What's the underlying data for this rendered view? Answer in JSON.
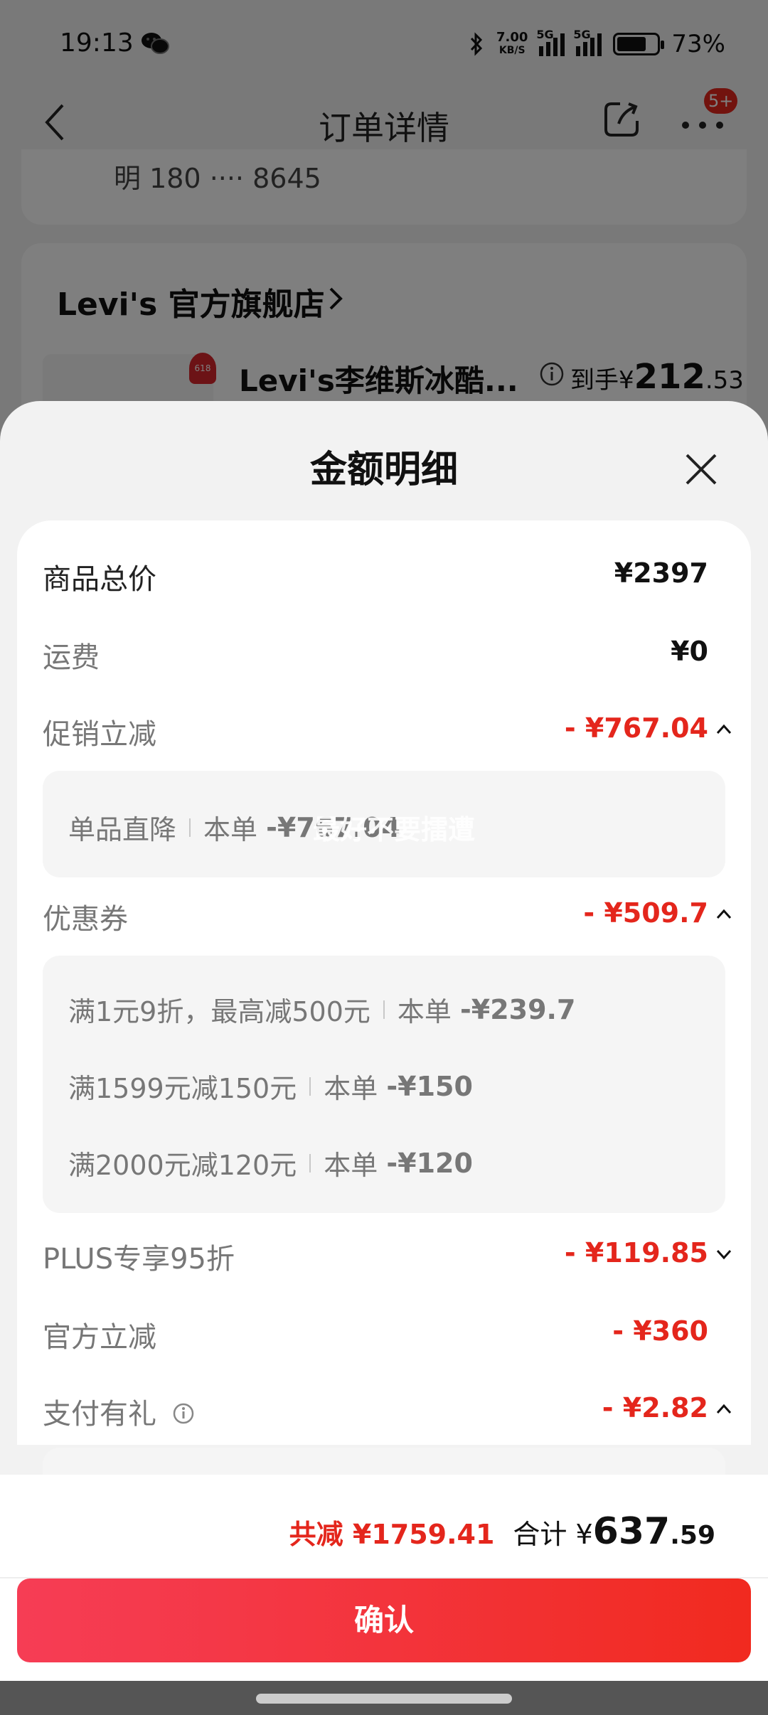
{
  "status_bar": {
    "time": "19:13",
    "net_speed_value": "7.00",
    "net_speed_unit": "KB/S",
    "signal1_label": "5G",
    "signal2_label": "5G",
    "battery": "73%",
    "battery_level": 0.73
  },
  "nav": {
    "title": "订单详情",
    "badge": "5+"
  },
  "background": {
    "masked_phone": "明 180 ···· 8645",
    "store_name": "Levi's 官方旗舰店",
    "product_name": "Levi's李维斯冰酷...",
    "price_prefix": "到手¥",
    "price_int": "212",
    "price_dec": ".53"
  },
  "sheet": {
    "title": "金额明细",
    "rows": {
      "goods_total": {
        "label": "商品总价",
        "value": "¥2397"
      },
      "shipping": {
        "label": "运费",
        "value": "¥0"
      },
      "promo": {
        "label": "促销立减",
        "value": "- ¥767.04"
      },
      "coupon": {
        "label": "优惠券",
        "value": "- ¥509.7"
      },
      "plus": {
        "label": "PLUS专享95折",
        "value": "- ¥119.85"
      },
      "official": {
        "label": "官方立减",
        "value": "- ¥360"
      },
      "payment": {
        "label": "支付有礼",
        "value": "- ¥2.82"
      }
    },
    "promo_details": [
      {
        "name": "单品直降",
        "amount_label": "本单",
        "amount": "-¥767.04"
      }
    ],
    "coupon_details": [
      {
        "name": "满1元9折，最高减500元",
        "amount_label": "本单",
        "amount": "-¥239.7"
      },
      {
        "name": "满1599元减150元",
        "amount_label": "本单",
        "amount": "-¥150"
      },
      {
        "name": "满2000元减120元",
        "amount_label": "本单",
        "amount": "-¥120"
      }
    ],
    "watermark": "最好不要擂遭"
  },
  "footer": {
    "total_discount": "共减 ¥1759.41",
    "total_label": "合计 ¥",
    "total_int": "637",
    "total_dec": ".59",
    "confirm_label": "确认"
  },
  "colors": {
    "accent_red": "#e4261c",
    "button_gradient_start": "#f63d55",
    "button_gradient_end": "#f12a1f"
  }
}
